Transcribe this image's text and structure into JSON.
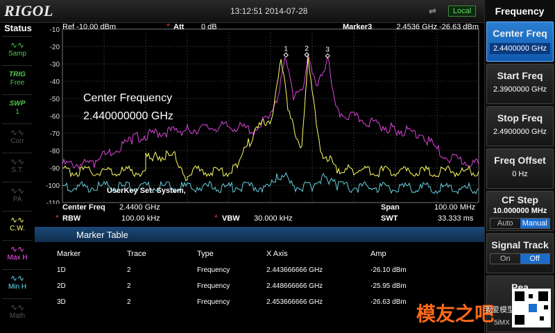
{
  "top": {
    "logo": "RIGOL",
    "datetime": "13:12:51 2014-07-28",
    "local": "Local",
    "usb_icon": "usb-icon"
  },
  "status": {
    "title": "Status",
    "items": [
      {
        "icon": "wave-icon",
        "label": "Samp",
        "color": "#4ec84e"
      },
      {
        "icon_text": "TRIG",
        "label": "Free",
        "color": "#4ec84e"
      },
      {
        "icon_text": "SWP",
        "label": "1",
        "color": "#4ec84e"
      },
      {
        "icon": "corr-icon",
        "label": "Corr",
        "color": "#555555"
      },
      {
        "icon": "st-icon",
        "label": "S.T.",
        "color": "#555555"
      },
      {
        "icon": "pa-icon",
        "label": "PA",
        "color": "#555555"
      },
      {
        "icon": "cw-icon",
        "label": "C.W.",
        "color": "#ffff66"
      },
      {
        "icon": "maxh-icon",
        "label": "Max H",
        "color": "#ff55ff"
      },
      {
        "icon": "minh-icon",
        "label": "Min H",
        "color": "#66e0ff"
      },
      {
        "icon": "math-icon",
        "label": "Math",
        "color": "#555555"
      }
    ]
  },
  "softkeys": {
    "title": "Frequency",
    "center": {
      "title": "Center Freq",
      "value": "2.4400000 GHz"
    },
    "start": {
      "title": "Start Freq",
      "value": "2.3900000 GHz"
    },
    "stop": {
      "title": "Stop Freq",
      "value": "2.4900000 GHz"
    },
    "offset": {
      "title": "Freq Offset",
      "value": "0 Hz"
    },
    "cfstep": {
      "title": "CF Step",
      "value": "10.000000 MHz",
      "opt_a": "Auto",
      "opt_b": "Manual"
    },
    "signal": {
      "title": "Signal Track",
      "opt_a": "On",
      "opt_b": "Off"
    },
    "peak": {
      "title": "Pea"
    }
  },
  "plot": {
    "ref": "Ref  -10.00 dBm",
    "att_label": "Att",
    "att_value": "0 dB",
    "marker_label": "Marker3",
    "marker_value": "2.4536 GHz   -26.63 dBm",
    "y_ticks": [
      "-10",
      "-20",
      "-30",
      "-40",
      "-50",
      "-60",
      "-70",
      "-80",
      "-90",
      "-100",
      "-110"
    ],
    "annotation_line1": "Center Frequency",
    "annotation_line2": "2.440000000 GHz",
    "userkey": "UserKey Set:  System,",
    "marker_labels": [
      "1",
      "2",
      "3"
    ]
  },
  "params": {
    "center_label": "Center Freq",
    "center_value": "2.4400 GHz",
    "span_label": "Span",
    "span_value": "100.00 MHz",
    "rbw_label": "RBW",
    "rbw_value": "100.00 kHz",
    "vbw_label": "VBW",
    "vbw_value": "30.000 kHz",
    "swt_label": "SWT",
    "swt_value": "33.333 ms"
  },
  "marker_table": {
    "title": "Marker Table",
    "headers": [
      "Marker",
      "Trace",
      "Type",
      "X Axis",
      "Amp"
    ],
    "rows": [
      [
        "1D",
        "2",
        "Frequency",
        "2.443666666 GHz",
        "-26.10 dBm"
      ],
      [
        "2D",
        "2",
        "Frequency",
        "2.448666666 GHz",
        "-25.95 dBm"
      ],
      [
        "3D",
        "2",
        "Frequency",
        "2.453666666 GHz",
        "-26.63 dBm"
      ]
    ]
  },
  "watermark": {
    "text1": "模友之吧",
    "text2": "我爱模型",
    "text3": "5iMX"
  },
  "chart_data": {
    "type": "line",
    "xlim": [
      2.39,
      2.49
    ],
    "ylim": [
      -110,
      -10
    ],
    "series": [
      {
        "color": "#dd44dd",
        "x": [
          2.39,
          2.398,
          2.4,
          2.407,
          2.412,
          2.42,
          2.43,
          2.436,
          2.4395,
          2.4415,
          2.4437,
          2.4455,
          2.448,
          2.449,
          2.451,
          2.4537,
          2.456,
          2.47,
          2.476,
          2.482,
          2.49
        ],
        "y": [
          -88,
          -88,
          -83,
          -73,
          -70,
          -68,
          -66,
          -68,
          -60,
          -50,
          -26,
          -50,
          -45,
          -26,
          -45,
          -27,
          -58,
          -68,
          -70,
          -84,
          -88
        ]
      },
      {
        "color": "#ffff66",
        "x": [
          2.39,
          2.41,
          2.41,
          2.412,
          2.417,
          2.419,
          2.42,
          2.42,
          2.43,
          2.432,
          2.436,
          2.4405,
          2.4425,
          2.4445,
          2.4475,
          2.449,
          2.452,
          2.456,
          2.46,
          2.47,
          2.49
        ],
        "y": [
          -92,
          -92,
          -84,
          -83,
          -83,
          -92,
          -96,
          -92,
          -92,
          -88,
          -70,
          -60,
          -28,
          -60,
          -78,
          -26,
          -80,
          -90,
          -92,
          -92,
          -92
        ]
      },
      {
        "color": "#66d0e0",
        "x": [
          2.39,
          2.44,
          2.4415,
          2.4437,
          2.446,
          2.45,
          2.451,
          2.4537,
          2.456,
          2.49
        ],
        "y": [
          -101,
          -101,
          -96,
          -92,
          -101,
          -101,
          -97,
          -96,
          -101,
          -102
        ]
      }
    ],
    "markers": [
      {
        "label": "1",
        "x": 2.4437,
        "y": -26.1
      },
      {
        "label": "2",
        "x": 2.4487,
        "y": -25.95
      },
      {
        "label": "3",
        "x": 2.4537,
        "y": -26.63
      }
    ]
  }
}
